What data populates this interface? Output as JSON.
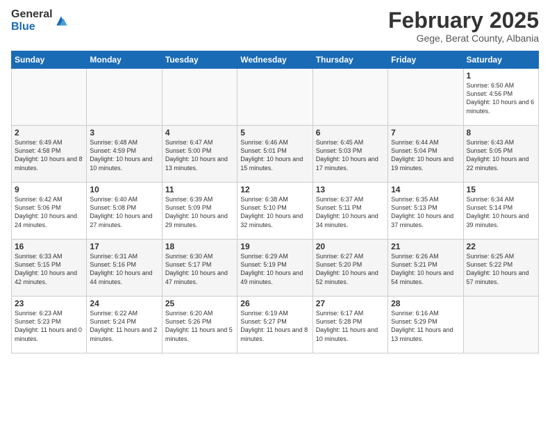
{
  "logo": {
    "general": "General",
    "blue": "Blue"
  },
  "header": {
    "month": "February 2025",
    "location": "Gege, Berat County, Albania"
  },
  "weekdays": [
    "Sunday",
    "Monday",
    "Tuesday",
    "Wednesday",
    "Thursday",
    "Friday",
    "Saturday"
  ],
  "weeks": [
    [
      null,
      null,
      null,
      null,
      null,
      null,
      {
        "day": "1",
        "sunrise": "Sunrise: 6:50 AM",
        "sunset": "Sunset: 4:56 PM",
        "daylight": "Daylight: 10 hours and 6 minutes."
      }
    ],
    [
      {
        "day": "2",
        "sunrise": "Sunrise: 6:49 AM",
        "sunset": "Sunset: 4:58 PM",
        "daylight": "Daylight: 10 hours and 8 minutes."
      },
      {
        "day": "3",
        "sunrise": "Sunrise: 6:48 AM",
        "sunset": "Sunset: 4:59 PM",
        "daylight": "Daylight: 10 hours and 10 minutes."
      },
      {
        "day": "4",
        "sunrise": "Sunrise: 6:47 AM",
        "sunset": "Sunset: 5:00 PM",
        "daylight": "Daylight: 10 hours and 13 minutes."
      },
      {
        "day": "5",
        "sunrise": "Sunrise: 6:46 AM",
        "sunset": "Sunset: 5:01 PM",
        "daylight": "Daylight: 10 hours and 15 minutes."
      },
      {
        "day": "6",
        "sunrise": "Sunrise: 6:45 AM",
        "sunset": "Sunset: 5:03 PM",
        "daylight": "Daylight: 10 hours and 17 minutes."
      },
      {
        "day": "7",
        "sunrise": "Sunrise: 6:44 AM",
        "sunset": "Sunset: 5:04 PM",
        "daylight": "Daylight: 10 hours and 19 minutes."
      },
      {
        "day": "8",
        "sunrise": "Sunrise: 6:43 AM",
        "sunset": "Sunset: 5:05 PM",
        "daylight": "Daylight: 10 hours and 22 minutes."
      }
    ],
    [
      {
        "day": "9",
        "sunrise": "Sunrise: 6:42 AM",
        "sunset": "Sunset: 5:06 PM",
        "daylight": "Daylight: 10 hours and 24 minutes."
      },
      {
        "day": "10",
        "sunrise": "Sunrise: 6:40 AM",
        "sunset": "Sunset: 5:08 PM",
        "daylight": "Daylight: 10 hours and 27 minutes."
      },
      {
        "day": "11",
        "sunrise": "Sunrise: 6:39 AM",
        "sunset": "Sunset: 5:09 PM",
        "daylight": "Daylight: 10 hours and 29 minutes."
      },
      {
        "day": "12",
        "sunrise": "Sunrise: 6:38 AM",
        "sunset": "Sunset: 5:10 PM",
        "daylight": "Daylight: 10 hours and 32 minutes."
      },
      {
        "day": "13",
        "sunrise": "Sunrise: 6:37 AM",
        "sunset": "Sunset: 5:11 PM",
        "daylight": "Daylight: 10 hours and 34 minutes."
      },
      {
        "day": "14",
        "sunrise": "Sunrise: 6:35 AM",
        "sunset": "Sunset: 5:13 PM",
        "daylight": "Daylight: 10 hours and 37 minutes."
      },
      {
        "day": "15",
        "sunrise": "Sunrise: 6:34 AM",
        "sunset": "Sunset: 5:14 PM",
        "daylight": "Daylight: 10 hours and 39 minutes."
      }
    ],
    [
      {
        "day": "16",
        "sunrise": "Sunrise: 6:33 AM",
        "sunset": "Sunset: 5:15 PM",
        "daylight": "Daylight: 10 hours and 42 minutes."
      },
      {
        "day": "17",
        "sunrise": "Sunrise: 6:31 AM",
        "sunset": "Sunset: 5:16 PM",
        "daylight": "Daylight: 10 hours and 44 minutes."
      },
      {
        "day": "18",
        "sunrise": "Sunrise: 6:30 AM",
        "sunset": "Sunset: 5:17 PM",
        "daylight": "Daylight: 10 hours and 47 minutes."
      },
      {
        "day": "19",
        "sunrise": "Sunrise: 6:29 AM",
        "sunset": "Sunset: 5:19 PM",
        "daylight": "Daylight: 10 hours and 49 minutes."
      },
      {
        "day": "20",
        "sunrise": "Sunrise: 6:27 AM",
        "sunset": "Sunset: 5:20 PM",
        "daylight": "Daylight: 10 hours and 52 minutes."
      },
      {
        "day": "21",
        "sunrise": "Sunrise: 6:26 AM",
        "sunset": "Sunset: 5:21 PM",
        "daylight": "Daylight: 10 hours and 54 minutes."
      },
      {
        "day": "22",
        "sunrise": "Sunrise: 6:25 AM",
        "sunset": "Sunset: 5:22 PM",
        "daylight": "Daylight: 10 hours and 57 minutes."
      }
    ],
    [
      {
        "day": "23",
        "sunrise": "Sunrise: 6:23 AM",
        "sunset": "Sunset: 5:23 PM",
        "daylight": "Daylight: 11 hours and 0 minutes."
      },
      {
        "day": "24",
        "sunrise": "Sunrise: 6:22 AM",
        "sunset": "Sunset: 5:24 PM",
        "daylight": "Daylight: 11 hours and 2 minutes."
      },
      {
        "day": "25",
        "sunrise": "Sunrise: 6:20 AM",
        "sunset": "Sunset: 5:26 PM",
        "daylight": "Daylight: 11 hours and 5 minutes."
      },
      {
        "day": "26",
        "sunrise": "Sunrise: 6:19 AM",
        "sunset": "Sunset: 5:27 PM",
        "daylight": "Daylight: 11 hours and 8 minutes."
      },
      {
        "day": "27",
        "sunrise": "Sunrise: 6:17 AM",
        "sunset": "Sunset: 5:28 PM",
        "daylight": "Daylight: 11 hours and 10 minutes."
      },
      {
        "day": "28",
        "sunrise": "Sunrise: 6:16 AM",
        "sunset": "Sunset: 5:29 PM",
        "daylight": "Daylight: 11 hours and 13 minutes."
      },
      null
    ]
  ]
}
